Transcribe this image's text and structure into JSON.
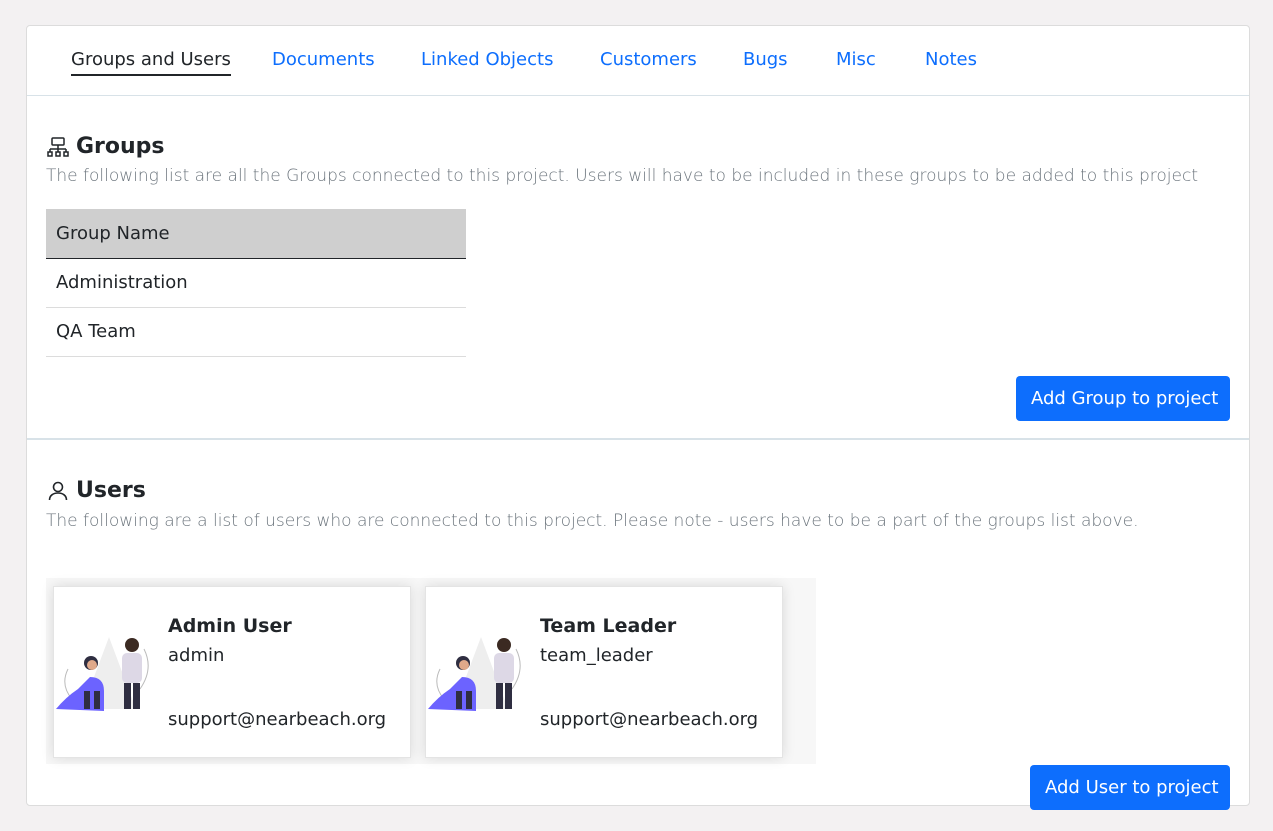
{
  "tabs": [
    {
      "label": "Groups and Users",
      "active": true
    },
    {
      "label": "Documents"
    },
    {
      "label": "Linked Objects"
    },
    {
      "label": "Customers"
    },
    {
      "label": "Bugs"
    },
    {
      "label": "Misc"
    },
    {
      "label": "Notes"
    }
  ],
  "groups": {
    "title": "Groups",
    "icon": "org-chart-icon",
    "description": "The following list are all the Groups connected to this project. Users will have to be included in these groups to be added to this project",
    "column_header": "Group Name",
    "rows": [
      "Administration",
      "QA Team"
    ],
    "add_button": "Add Group to project"
  },
  "users": {
    "title": "Users",
    "icon": "person-icon",
    "description": "The following are a list of users who are connected to this project. Please note - users have to be a part of the groups list above.",
    "cards": [
      {
        "name": "Admin User",
        "username": "admin",
        "email": "support@nearbeach.org"
      },
      {
        "name": "Team Leader",
        "username": "team_leader",
        "email": "support@nearbeach.org"
      }
    ],
    "add_button": "Add User to project"
  },
  "colors": {
    "primary": "#0d6efd",
    "header_bg": "#cfcfcf",
    "page_bg": "#f3f1f2"
  }
}
